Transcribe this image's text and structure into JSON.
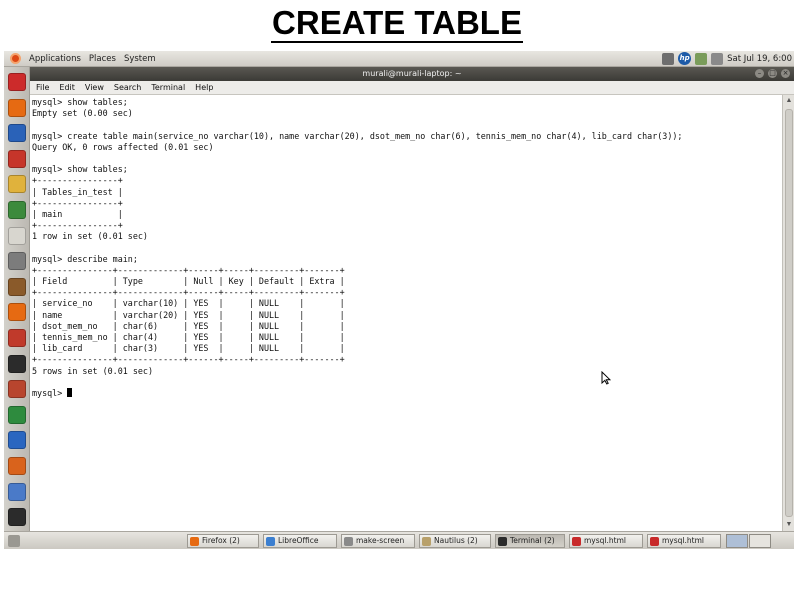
{
  "slide": {
    "title": "CREATE TABLE"
  },
  "top_panel": {
    "menus": [
      "Applications",
      "Places",
      "System"
    ],
    "clock": "Sat Jul 19, 6:00"
  },
  "launcher_icons": [
    {
      "name": "terminal-icon",
      "color": "#cc2b2b"
    },
    {
      "name": "firefox-icon",
      "color": "#e66a12"
    },
    {
      "name": "help-icon",
      "color": "#2a62b8"
    },
    {
      "name": "text-editor-icon",
      "color": "#c6352a"
    },
    {
      "name": "notes-icon",
      "color": "#e0b23c"
    },
    {
      "name": "spreadsheet-icon",
      "color": "#3c8a3c"
    },
    {
      "name": "document-icon",
      "color": "#d8d6cf"
    },
    {
      "name": "calculator-icon",
      "color": "#7c7c7c"
    },
    {
      "name": "dictionary-icon",
      "color": "#8a5a2a"
    },
    {
      "name": "firefox-icon",
      "color": "#e66a12"
    },
    {
      "name": "openoffice-icon",
      "color": "#c03a2b"
    },
    {
      "name": "terminal-icon",
      "color": "#2b2b2b"
    },
    {
      "name": "software-center-icon",
      "color": "#b8452e"
    },
    {
      "name": "libreoffice-calc-icon",
      "color": "#2e8b3e"
    },
    {
      "name": "libreoffice-writer-icon",
      "color": "#2a66c0"
    },
    {
      "name": "libreoffice-impress-icon",
      "color": "#d9631c"
    },
    {
      "name": "image-viewer-icon",
      "color": "#4a7ac8"
    },
    {
      "name": "system-monitor-icon",
      "color": "#2b2b2b"
    }
  ],
  "terminal": {
    "title": "murali@murali-laptop: ~",
    "menu": [
      "File",
      "Edit",
      "View",
      "Search",
      "Terminal",
      "Help"
    ],
    "lines": [
      "mysql> show tables;",
      "Empty set (0.00 sec)",
      "",
      "mysql> create table main(service_no varchar(10), name varchar(20), dsot_mem_no char(6), tennis_mem_no char(4), lib_card char(3));",
      "Query OK, 0 rows affected (0.01 sec)",
      "",
      "mysql> show tables;",
      "+----------------+",
      "| Tables_in_test |",
      "+----------------+",
      "| main           |",
      "+----------------+",
      "1 row in set (0.01 sec)",
      "",
      "mysql> describe main;",
      "+---------------+-------------+------+-----+---------+-------+",
      "| Field         | Type        | Null | Key | Default | Extra |",
      "+---------------+-------------+------+-----+---------+-------+",
      "| service_no    | varchar(10) | YES  |     | NULL    |       |",
      "| name          | varchar(20) | YES  |     | NULL    |       |",
      "| dsot_mem_no   | char(6)     | YES  |     | NULL    |       |",
      "| tennis_mem_no | char(4)     | YES  |     | NULL    |       |",
      "| lib_card      | char(3)     | YES  |     | NULL    |       |",
      "+---------------+-------------+------+-----+---------+-------+",
      "5 rows in set (0.01 sec)",
      "",
      "mysql> "
    ]
  },
  "taskbar": [
    {
      "label": "Firefox (2)",
      "icon": "firefox-icon",
      "color": "#e66a12"
    },
    {
      "label": "LibreOffice",
      "icon": "libreoffice-icon",
      "color": "#3c7fd0"
    },
    {
      "label": "make-screen",
      "icon": "app-icon",
      "color": "#8a8a8a"
    },
    {
      "label": "Nautilus (2)",
      "icon": "folder-icon",
      "color": "#b8a06a"
    },
    {
      "label": "Terminal (2)",
      "icon": "terminal-icon",
      "color": "#2b2b2b",
      "active": true
    },
    {
      "label": "mysql.html",
      "icon": "pdf-icon",
      "color": "#c82a2a"
    },
    {
      "label": "mysql.html",
      "icon": "pdf-icon",
      "color": "#c82a2a"
    }
  ]
}
